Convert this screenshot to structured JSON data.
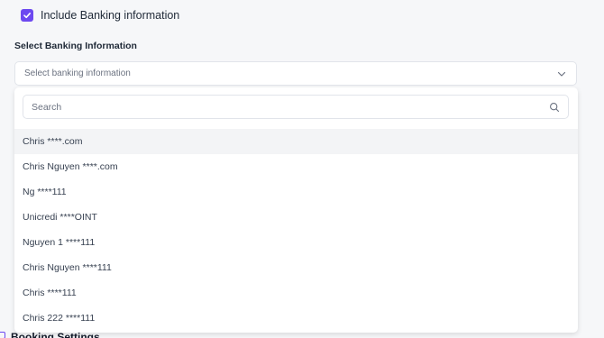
{
  "include_banking": {
    "checked": true,
    "label": "Include Banking information"
  },
  "banking_select": {
    "section_label": "Select Banking Information",
    "placeholder": "Select banking information"
  },
  "dropdown": {
    "search_placeholder": "Search",
    "options": [
      "Chris ****.com",
      "Chris Nguyen ****.com",
      "Ng ****111",
      "Unicredi ****OINT",
      "Nguyen 1 ****111",
      "Chris Nguyen ****111",
      "Chris ****111",
      "Chris 222 ****111"
    ],
    "highlighted_index": 0
  },
  "next_section": {
    "title": "Booking Settings"
  },
  "colors": {
    "accent": "#6d49f0"
  }
}
